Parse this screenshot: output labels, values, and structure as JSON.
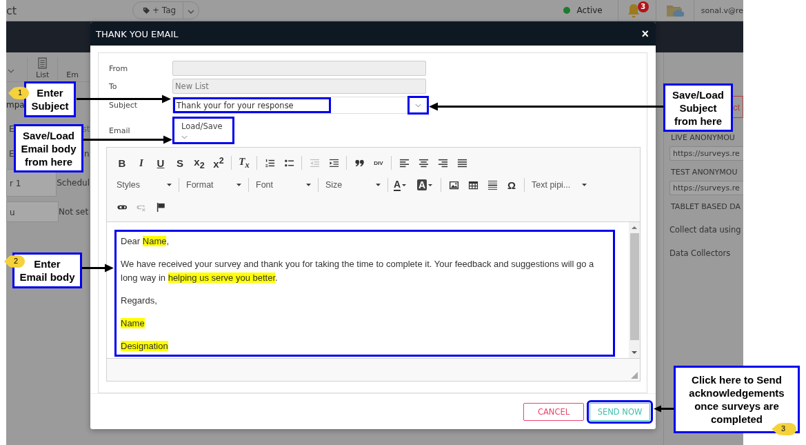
{
  "app_bar": {
    "title": "ct",
    "tag_button": "+ Tag",
    "status": "Active",
    "notification_count": "3",
    "user": "sonal.v@re"
  },
  "view_tabs": [
    {
      "label": "List"
    },
    {
      "label": "Em"
    }
  ],
  "left_panel": {
    "heading": "mpa",
    "rows": [
      {
        "column_1": "E",
        "column_2": "st"
      },
      {
        "column_1": "E",
        "column_2": "n"
      },
      {
        "column_1": "r 1",
        "column_2": "Schedul"
      },
      {
        "column_1": "u",
        "column_2": "Not set"
      }
    ]
  },
  "right_panel": {
    "button": "ct",
    "sections": [
      {
        "heading": "LIVE ANONYMOU",
        "link": "https://surveys.re"
      },
      {
        "heading": "TEST ANONYMOU",
        "link": "https://surveys.re"
      },
      {
        "heading": "TABLET BASED DA"
      }
    ],
    "items": [
      "Collect data using",
      "Data Collectors"
    ]
  },
  "dialog": {
    "title": "THANK YOU EMAIL",
    "close": "×",
    "fields": [
      {
        "label": "From",
        "disabled": true
      },
      {
        "label": "To",
        "value": "New List",
        "disabled": true
      },
      {
        "label": "Subject",
        "value": "Thank your for your response",
        "disabled": false
      }
    ],
    "email_label": "Email",
    "load_save": "Load/Save",
    "toolbar": [
      [
        [
          {
            "kind": "glyph",
            "label": "B"
          },
          {
            "kind": "glyph",
            "label": "I"
          },
          {
            "kind": "glyph",
            "label": "U"
          },
          {
            "kind": "glyph",
            "label": "S"
          },
          {
            "kind": "glyph",
            "label": "x$_{2}$"
          },
          {
            "kind": "glyph",
            "label": "x$^{2}$"
          }
        ],
        [
          {
            "kind": "glyph",
            "label": "T$_{x}$"
          }
        ],
        [
          {
            "kind": "icon",
            "disabled": false
          },
          {
            "kind": "icon",
            "disabled": false
          }
        ],
        [
          {
            "kind": "icon",
            "disabled": true
          },
          {
            "kind": "icon",
            "disabled": false
          }
        ],
        [
          {
            "kind": "icon",
            "disabled": false
          },
          {
            "kind": "glyph",
            "label": "DIV"
          }
        ],
        [
          {
            "kind": "icon",
            "disabled": false
          },
          {
            "kind": "icon",
            "disabled": false
          },
          {
            "kind": "icon",
            "disabled": false
          },
          {
            "kind": "icon",
            "disabled": false
          }
        ]
      ],
      [
        [
          {
            "kind": "dropdown",
            "label": "Styles"
          }
        ],
        [
          {
            "kind": "dropdown",
            "label": "Format"
          }
        ],
        [
          {
            "kind": "dropdown",
            "label": "Font"
          }
        ],
        [
          {
            "kind": "dropdown",
            "label": "Size"
          }
        ],
        [
          {
            "kind": "color",
            "label": "A"
          },
          {
            "kind": "color",
            "label": "A"
          }
        ],
        [
          {
            "kind": "icon",
            "disabled": false
          },
          {
            "kind": "icon",
            "disabled": false
          },
          {
            "kind": "icon",
            "disabled": false
          },
          {
            "kind": "glyph",
            "label": "Ω"
          }
        ],
        [
          {
            "kind": "dropdown",
            "label": "Text pipi..."
          }
        ]
      ],
      [
        [
          {
            "kind": "icon",
            "disabled": false
          },
          {
            "kind": "icon",
            "disabled": true
          },
          {
            "kind": "icon",
            "disabled": false
          }
        ]
      ]
    ],
    "body": [
      {
        "segments": [
          {
            "text": "Dear ",
            "highlighted": false
          },
          {
            "text": "Name",
            "highlighted": true
          },
          {
            "text": ",",
            "highlighted": false
          }
        ]
      },
      {
        "segments": [
          {
            "text": "We have received your survey and thank you for taking the time to complete it. Your feedback and suggestions will go a long way in ",
            "highlighted": false
          },
          {
            "text": "helping us serve you better",
            "highlighted": true
          },
          {
            "text": ".",
            "highlighted": false
          }
        ]
      },
      {
        "segments": [
          {
            "text": "Regards,",
            "highlighted": false
          }
        ]
      },
      {
        "segments": [
          {
            "text": "Name",
            "highlighted": true
          }
        ]
      },
      {
        "segments": [
          {
            "text": "Designation",
            "highlighted": true
          }
        ]
      }
    ],
    "buttons": [
      {
        "label": "CANCEL",
        "kind": "cancel"
      },
      {
        "label": "SEND NOW",
        "kind": "primary"
      }
    ]
  },
  "callouts": [
    {
      "marker": "1",
      "lines": [
        "Enter",
        "Subject"
      ]
    },
    {
      "lines": [
        "Save/Load",
        "Email body",
        "from here"
      ]
    },
    {
      "marker": "2",
      "lines": [
        "Enter",
        "Email body"
      ]
    },
    {
      "lines": [
        "Save/Load",
        "Subject",
        "from here"
      ]
    },
    {
      "marker": "3",
      "lines": [
        "Click here to Send",
        "acknowledgements",
        "once surveys are",
        "completed"
      ]
    }
  ]
}
